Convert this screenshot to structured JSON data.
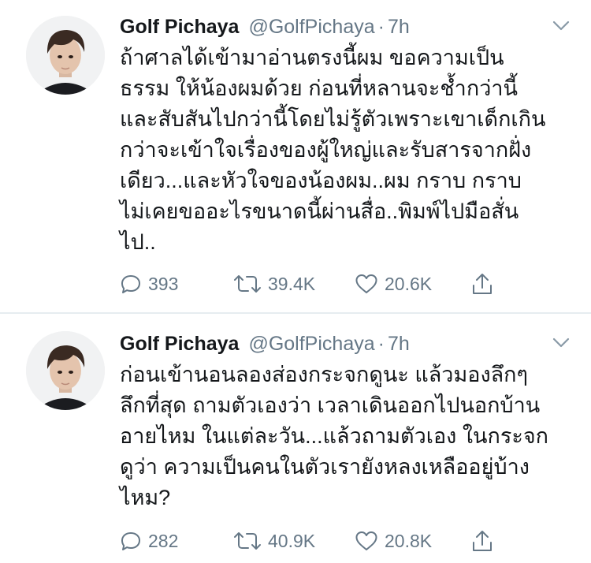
{
  "tweets": [
    {
      "display_name": "Golf Pichaya",
      "handle": "@GolfPichaya",
      "separator": "·",
      "time": "7h",
      "lines": [
        "ถ้าศาลได้เข้ามาอ่านตรงนี้ผม ขอความเป็น",
        "ธรรม ให้น้องผมด้วย ก่อนที่หลานจะช้ำกว่านี้",
        "และสับสันไปกว่านี้โดยไม่รู้ตัวเพราะเขาเด็กเกิน",
        "กว่าจะเข้าใจเรื่องของผู้ใหญ่และรับสารจากฝั่ง",
        "เดียว...และหัวใจของน้องผม..ผม กราบ กราบ",
        "ไม่เคยขออะไรขนาดนี้ผ่านสื่อ..พิมพ์ไปมือสั่น",
        "ไป.."
      ],
      "replies": "393",
      "retweets": "39.4K",
      "likes": "20.6K"
    },
    {
      "display_name": "Golf Pichaya",
      "handle": "@GolfPichaya",
      "separator": "·",
      "time": "7h",
      "lines": [
        "ก่อนเข้านอนลองส่องกระจกดูนะ แล้วมองลึกๆ",
        "ลึกที่สุด ถามตัวเองว่า เวลาเดินออกไปนอกบ้าน",
        "อายไหม ในแต่ละวัน...แล้วถามตัวเอง ในกระจก",
        "ดูว่า ความเป็นคนในตัวเรายังหลงเหลืออยู่บ้าง",
        "ไหม?"
      ],
      "replies": "282",
      "retweets": "40.9K",
      "likes": "20.8K"
    }
  ],
  "icons": {
    "reply": "reply-icon",
    "retweet": "retweet-icon",
    "like": "heart-icon",
    "share": "share-icon",
    "caret": "chevron-down-icon"
  },
  "colors": {
    "text": "#14171a",
    "secondary": "#657786",
    "divider": "#e6ecf0"
  }
}
